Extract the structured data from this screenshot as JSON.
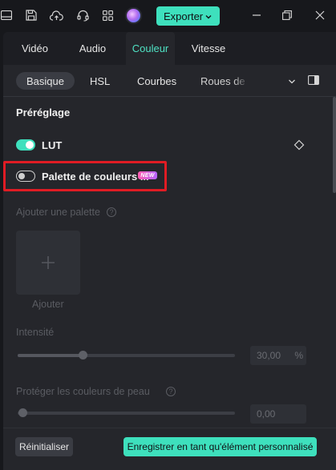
{
  "titlebar": {
    "export_label": "Exporter"
  },
  "tabs": [
    {
      "label": "Vidéo"
    },
    {
      "label": "Audio"
    },
    {
      "label": "Couleur",
      "active": true
    },
    {
      "label": "Vitesse"
    }
  ],
  "subtabs": [
    {
      "label": "Basique",
      "active": true
    },
    {
      "label": "HSL"
    },
    {
      "label": "Courbes"
    },
    {
      "label": "Roues de c"
    }
  ],
  "preset": {
    "title": "Préréglage",
    "lut_label": "LUT",
    "lut_enabled": true,
    "palette_label": "Palette de couleurs ...",
    "palette_enabled": false,
    "new_badge": "NEW"
  },
  "palette": {
    "add_palette_label": "Ajouter une palette",
    "add_label": "Ajouter"
  },
  "intensity": {
    "label": "Intensité",
    "value": "30,00",
    "unit": "%",
    "fraction": 0.3
  },
  "skin": {
    "label": "Protéger les couleurs de peau",
    "value": "0,00",
    "fraction": 0.0
  },
  "footer": {
    "reset_label": "Réinitialiser",
    "save_label": "Enregistrer en tant qu'élément personnalisé"
  },
  "colors": {
    "accent": "#3ee0bd",
    "highlight": "#e01c24",
    "background": "#25262b"
  }
}
